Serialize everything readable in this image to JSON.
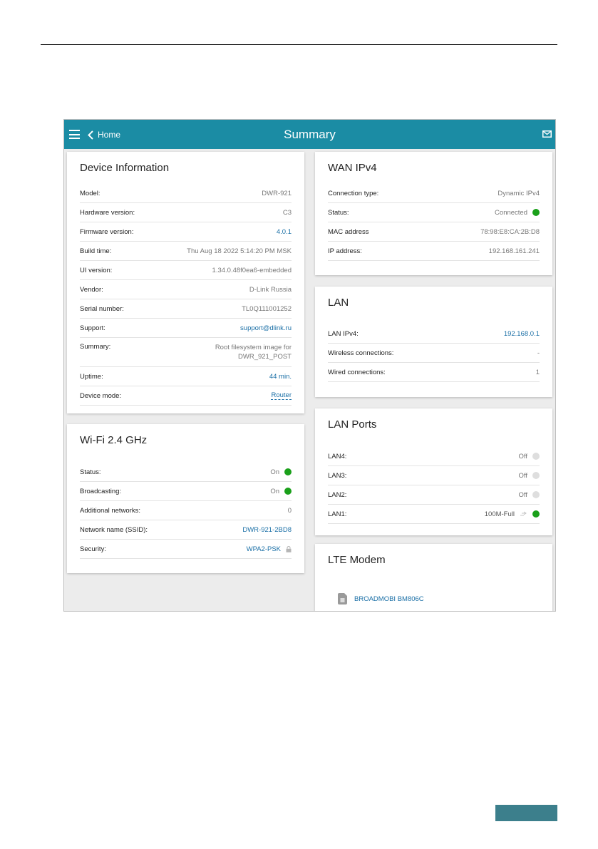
{
  "appbar": {
    "back_label": "Home",
    "title": "Summary"
  },
  "device_info": {
    "title": "Device Information",
    "rows": [
      {
        "label": "Model:",
        "value": "DWR-921"
      },
      {
        "label": "Hardware version:",
        "value": "C3"
      },
      {
        "label": "Firmware version:",
        "value": "4.0.1"
      },
      {
        "label": "Build time:",
        "value": "Thu Aug 18 2022 5:14:20 PM MSK"
      },
      {
        "label": "UI version:",
        "value": "1.34.0.48f0ea6-embedded"
      },
      {
        "label": "Vendor:",
        "value": "D-Link Russia"
      },
      {
        "label": "Serial number:",
        "value": "TL0Q111001252"
      },
      {
        "label": "Support:",
        "value": "support@dlink.ru"
      },
      {
        "label": "Summary:",
        "value_line1": "Root filesystem image for",
        "value_line2": "DWR_921_POST"
      },
      {
        "label": "Uptime:",
        "value": "44 min."
      },
      {
        "label": "Device mode:",
        "value": "Router"
      }
    ]
  },
  "wifi": {
    "title": "Wi-Fi 2.4 GHz",
    "rows": [
      {
        "label": "Status:",
        "value": "On"
      },
      {
        "label": "Broadcasting:",
        "value": "On"
      },
      {
        "label": "Additional networks:",
        "value": "0"
      },
      {
        "label": "Network name (SSID):",
        "value": "DWR-921-2BD8"
      },
      {
        "label": "Security:",
        "value": "WPA2-PSK"
      }
    ]
  },
  "wan": {
    "title": "WAN IPv4",
    "rows": [
      {
        "label": "Connection type:",
        "value": "Dynamic IPv4"
      },
      {
        "label": "Status:",
        "value": "Connected"
      },
      {
        "label": "MAC address",
        "value": "78:98:E8:CA:2B:D8"
      },
      {
        "label": "IP address:",
        "value": "192.168.161.241"
      }
    ]
  },
  "lan": {
    "title": "LAN",
    "rows": [
      {
        "label": "LAN IPv4:",
        "value": "192.168.0.1"
      },
      {
        "label": "Wireless connections:",
        "value": "-"
      },
      {
        "label": "Wired connections:",
        "value": "1"
      }
    ]
  },
  "lan_ports": {
    "title": "LAN Ports",
    "rows": [
      {
        "label": "LAN4:",
        "value": "Off",
        "state": "off"
      },
      {
        "label": "LAN3:",
        "value": "Off",
        "state": "off"
      },
      {
        "label": "LAN2:",
        "value": "Off",
        "state": "off"
      },
      {
        "label": "LAN1:",
        "value": "100M-Full",
        "state": "on"
      }
    ]
  },
  "lte": {
    "title": "LTE Modem",
    "modem_name": "BROADMOBI BM806C"
  },
  "colors": {
    "appbar": "#1b8ca4",
    "link": "#1a6fa6",
    "status_on": "#1aa01a",
    "status_off": "#dedede",
    "page_tab": "#3c7f8c"
  }
}
